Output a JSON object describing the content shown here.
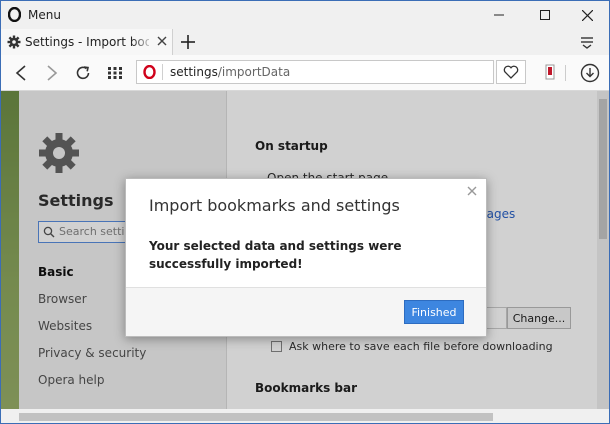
{
  "titlebar": {
    "menu_label": "Menu"
  },
  "tab": {
    "title": "Settings - Import bookmarks"
  },
  "address": {
    "host": "settings",
    "path": "/importData"
  },
  "sidebar": {
    "heading": "Settings",
    "search_placeholder": "Search settings",
    "items": [
      {
        "label": "Basic",
        "active": true
      },
      {
        "label": "Browser"
      },
      {
        "label": "Websites"
      },
      {
        "label": "Privacy & security"
      },
      {
        "label": "Opera help"
      }
    ]
  },
  "content": {
    "startup_heading": "On startup",
    "startup_option": "Open the start page",
    "pages_link": "pages",
    "change_button": "Change...",
    "ask_download": "Ask where to save each file before downloading",
    "bookmarks_heading": "Bookmarks bar"
  },
  "dialog": {
    "title": "Import bookmarks and settings",
    "message": "Your selected data and settings were successfully imported!",
    "finished_button": "Finished"
  },
  "colors": {
    "accent": "#3d86e0",
    "link": "#2a62c9",
    "opera_red": "#d0021b"
  }
}
